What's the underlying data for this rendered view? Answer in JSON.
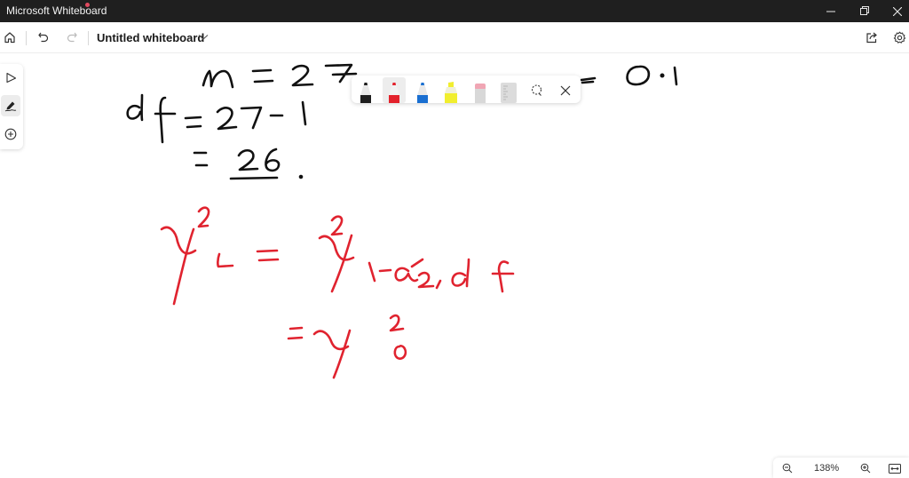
{
  "window": {
    "app_title": "Microsoft Whiteboard",
    "controls": {
      "minimize": "minimize",
      "restore": "restore",
      "close": "close"
    }
  },
  "toolbar": {
    "home_icon": "home-icon",
    "undo_icon": "undo-icon",
    "redo_icon": "redo-icon",
    "document_title": "Untitled whiteboard",
    "share_icon": "share-icon",
    "settings_icon": "gear-icon"
  },
  "left_rail": {
    "items": [
      {
        "name": "select",
        "icon": "pointer-icon",
        "active": false
      },
      {
        "name": "inking",
        "icon": "pen-icon",
        "active": true
      },
      {
        "name": "add",
        "icon": "plus-circle-icon",
        "active": false
      }
    ]
  },
  "pen_tray": {
    "tools": [
      {
        "name": "black-pen",
        "color": "#1e1e1e",
        "active": false
      },
      {
        "name": "red-pen",
        "color": "#e3222c",
        "active": true
      },
      {
        "name": "blue-pen",
        "color": "#1a6fd1",
        "active": false
      },
      {
        "name": "yellow-highlighter",
        "color": "#f1ee2e",
        "active": false
      },
      {
        "name": "eraser",
        "color": "#f0a6b4",
        "active": false
      },
      {
        "name": "ruler",
        "color": "#cfcfcf",
        "active": false
      },
      {
        "name": "lasso-select",
        "active": false
      }
    ],
    "close_icon": "close-icon"
  },
  "canvas": {
    "ink_colors": {
      "black": "#111111",
      "red": "#e0232f"
    },
    "handwritten": [
      "n = 27",
      "= 0.1",
      "df = 27 - 1",
      "= 26",
      "χ²_L = χ²_{1-α/2, df}",
      "= χ²_0"
    ]
  },
  "zoom_bar": {
    "zoom_out_icon": "zoom-out-icon",
    "level": "138%",
    "zoom_in_icon": "zoom-in-icon",
    "fit_icon": "fit-to-screen-icon"
  }
}
